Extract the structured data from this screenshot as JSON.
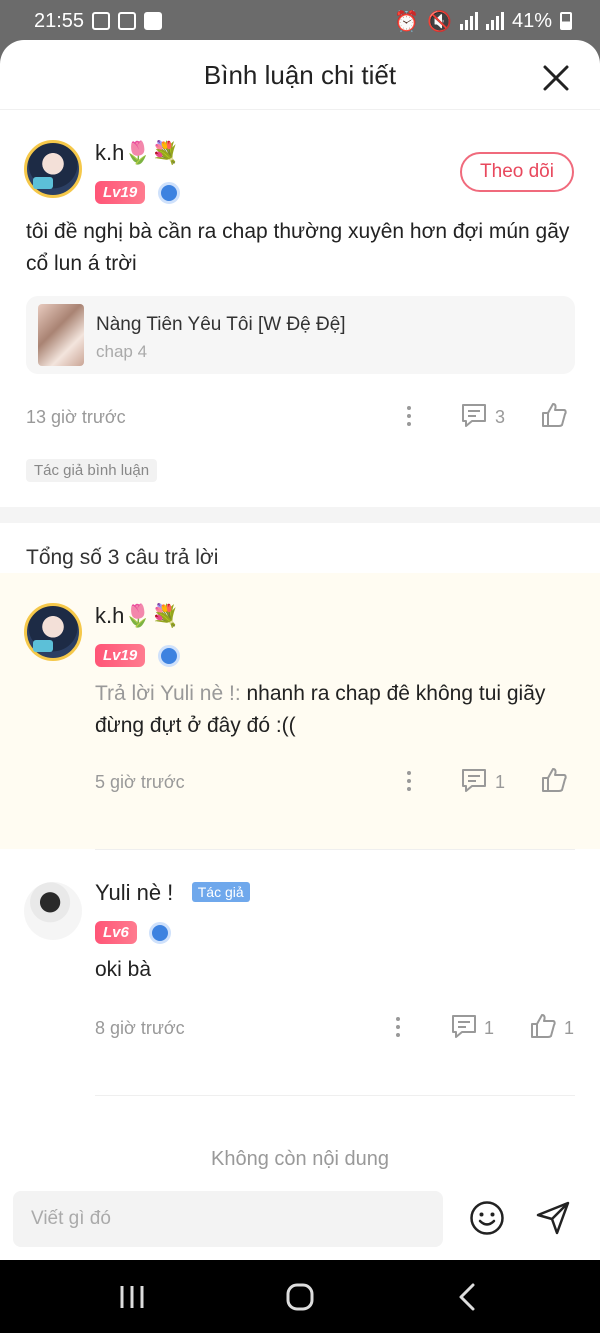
{
  "status": {
    "time": "21:55",
    "battery": "41%"
  },
  "header": {
    "title": "Bình luận chi tiết"
  },
  "main_comment": {
    "username": "k.h🌷💐",
    "level": "Lv19",
    "follow_label": "Theo dõi",
    "text": "tôi đề nghị bà cần ra chap thường xuyên hơn đợi mún gãy cổ lun á trời",
    "post": {
      "title": "Nàng Tiên Yêu Tôi [W Đệ Đệ]",
      "chapter": "chap 4"
    },
    "time": "13 giờ trước",
    "reply_count": "3",
    "tag": "Tác giả bình luận"
  },
  "replies_header": "Tổng số 3 câu trả lời",
  "replies": [
    {
      "username": "k.h🌷💐",
      "level": "Lv19",
      "reply_prefix": "Trả lời Yuli nè !:",
      "text": " nhanh ra chap đê không tui giãy đừng đựt ở đây đó :((",
      "time": "5 giờ trước",
      "reply_count": "1"
    },
    {
      "username": "Yuli nè !",
      "badge": "Tác giả",
      "level": "Lv6",
      "text": "oki bà",
      "time": "8 giờ trước",
      "reply_count": "1",
      "like_count": "1"
    }
  ],
  "end_text": "Không còn nội dung",
  "composer": {
    "placeholder": "Viết gì đó"
  }
}
